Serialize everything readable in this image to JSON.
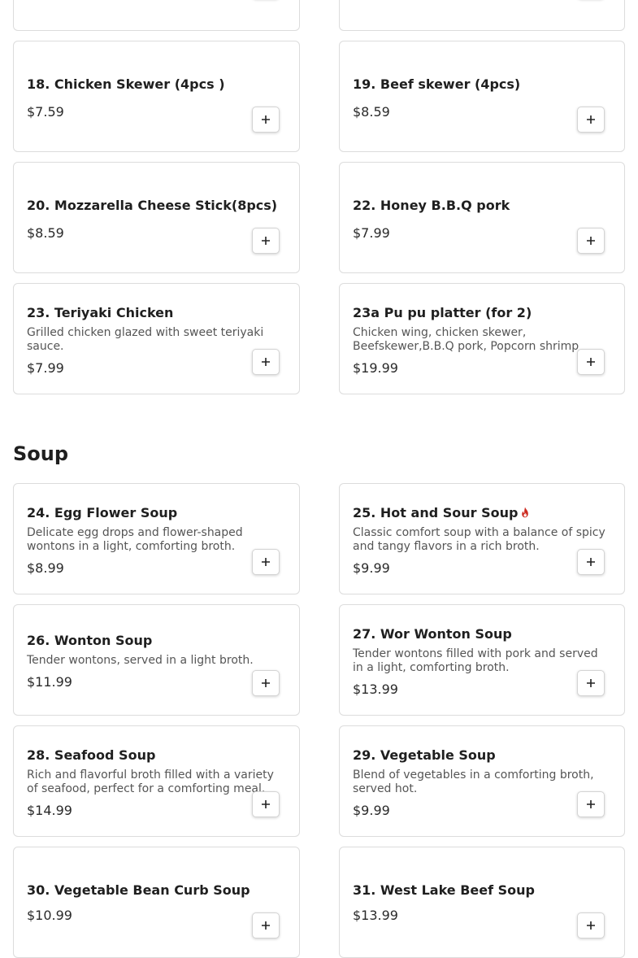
{
  "sections": {
    "soup_title": "Soup"
  },
  "accent": {
    "spicy": "#cc2a1f"
  },
  "items": [
    {
      "name": "",
      "description": "",
      "price": ""
    },
    {
      "name": "",
      "description": "",
      "price": ""
    },
    {
      "name": "18. Chicken Skewer (4pcs )",
      "description": "",
      "price": "$7.59"
    },
    {
      "name": "19. Beef skewer (4pcs)",
      "description": "",
      "price": "$8.59"
    },
    {
      "name": "20. Mozzarella Cheese Stick(8pcs)",
      "description": "",
      "price": "$8.59"
    },
    {
      "name": "22. Honey B.B.Q pork",
      "description": "",
      "price": "$7.99"
    },
    {
      "name": "23. Teriyaki Chicken",
      "description": "Grilled chicken glazed with sweet teriyaki sauce.",
      "price": "$7.99"
    },
    {
      "name": "23a Pu pu platter (for 2)",
      "description": "Chicken wing, chicken skewer, Beefskewer,B.B.Q pork, Popcorn shrimp",
      "price": "$19.99"
    },
    {
      "name": "24. Egg Flower Soup",
      "description": "Delicate egg drops and flower-shaped wontons in a light, comforting broth.",
      "price": "$8.99"
    },
    {
      "name": "25. Hot and Sour Soup",
      "description": "Classic comfort soup with a balance of spicy and tangy flavors in a rich broth.",
      "price": "$9.99",
      "badge_icon": "spicy-flame-icon"
    },
    {
      "name": "26. Wonton Soup",
      "description": "Tender wontons, served in a light broth.",
      "price": "$11.99"
    },
    {
      "name": "27. Wor Wonton Soup",
      "description": "Tender wontons filled with pork and served in a light, comforting broth.",
      "price": "$13.99"
    },
    {
      "name": "28. Seafood Soup",
      "description": "Rich and flavorful broth filled with a variety of seafood, perfect for a comforting meal.",
      "price": "$14.99"
    },
    {
      "name": "29. Vegetable Soup",
      "description": "Blend of vegetables in a comforting broth, served hot.",
      "price": "$9.99"
    },
    {
      "name": "30. Vegetable Bean Curb Soup",
      "description": "",
      "price": "$10.99"
    },
    {
      "name": "31. West Lake Beef Soup",
      "description": "",
      "price": "$13.99"
    }
  ],
  "icons": {
    "add": "plus-icon"
  }
}
